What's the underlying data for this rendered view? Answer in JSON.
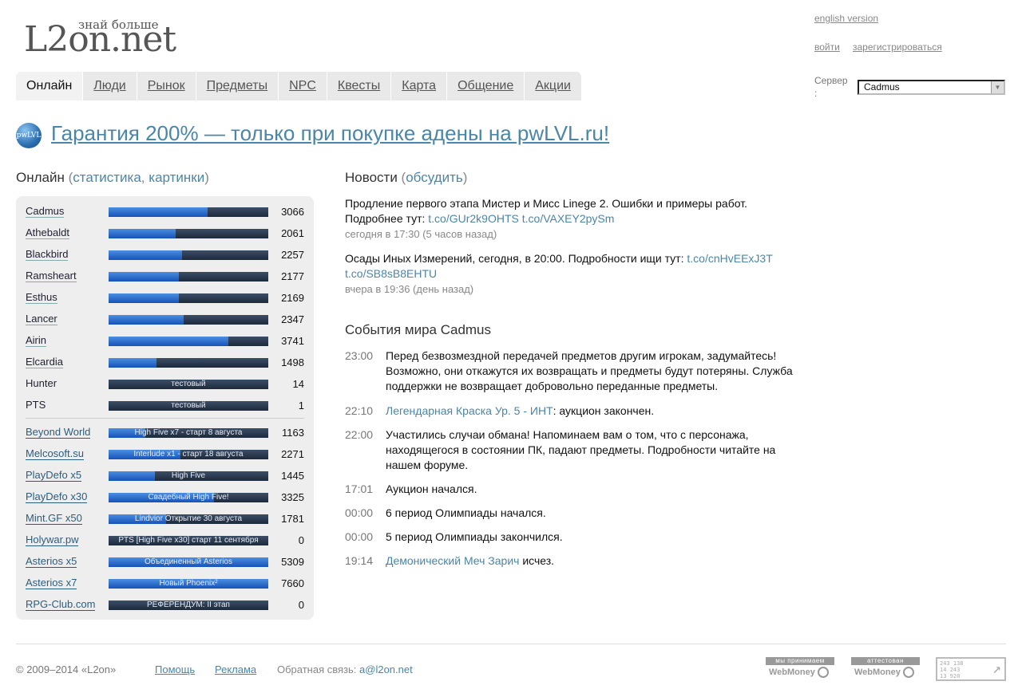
{
  "header": {
    "logo_text": "L2on.net",
    "logo_tagline": "знай больше",
    "english_link": "english version",
    "login_link": "войти",
    "register_link": "зарегистрироваться",
    "server_label": "Сервер :",
    "server_selected": "Cadmus"
  },
  "tabs": [
    {
      "label": "Онлайн",
      "active": true
    },
    {
      "label": "Люди"
    },
    {
      "label": "Рынок"
    },
    {
      "label": "Предметы"
    },
    {
      "label": "NPC"
    },
    {
      "label": "Квесты"
    },
    {
      "label": "Карта"
    },
    {
      "label": "Общение"
    },
    {
      "label": "Акции"
    }
  ],
  "banner": {
    "icon_text": "pwLVL",
    "text": "Гарантия 200% — только при покупке адены на pwLVL.ru!"
  },
  "online": {
    "title": "Онлайн",
    "paren_open": "(",
    "stats_link": "статистика",
    "comma": ",",
    "pics_link": "картинки",
    "paren_close": ")",
    "servers": [
      {
        "name": "Cadmus",
        "count": "3066",
        "fill": 0.62
      },
      {
        "name": "Athebaldt",
        "count": "2061",
        "fill": 0.42
      },
      {
        "name": "Blackbird",
        "count": "2257",
        "fill": 0.46
      },
      {
        "name": "Ramsheart",
        "count": "2177",
        "fill": 0.44
      },
      {
        "name": "Esthus",
        "count": "2169",
        "fill": 0.44
      },
      {
        "name": "Lancer",
        "count": "2347",
        "fill": 0.47
      },
      {
        "name": "Airin",
        "count": "3741",
        "fill": 0.75
      },
      {
        "name": "Elcardia",
        "count": "1498",
        "fill": 0.3
      },
      {
        "name": "Hunter",
        "count": "14",
        "fill": 0,
        "bar_text": "тестовый"
      },
      {
        "name": "PTS",
        "count": "1",
        "fill": 0,
        "bar_text": "тестовый"
      }
    ],
    "partners": [
      {
        "name": "Beyond World",
        "count": "1163",
        "fill": 0.23,
        "bar_text": "High Five x7 - старт 8 августа"
      },
      {
        "name": "Melcosoft.su",
        "count": "2271",
        "fill": 0.45,
        "bar_text": "Interlude x1 - старт 18 августа"
      },
      {
        "name": "PlayDefo x5",
        "count": "1445",
        "fill": 0.29,
        "bar_text": "High Five"
      },
      {
        "name": "PlayDefo x30",
        "count": "3325",
        "fill": 0.66,
        "bar_text": "Свадебный High Five!"
      },
      {
        "name": "Mint.GF x50",
        "count": "1781",
        "fill": 0.36,
        "bar_text": "Lindvior Открытие 30 августа"
      },
      {
        "name": "Holywar.pw",
        "count": "0",
        "fill": 0,
        "bar_text": "PTS [High Five x30] старт 11 сентября"
      },
      {
        "name": "Asterios x5",
        "count": "5309",
        "fill": 1.0,
        "bar_text": "Объединенный Asterios"
      },
      {
        "name": "Asterios x7",
        "count": "7660",
        "fill": 1.0,
        "bar_text": "Новый Phoenix²"
      },
      {
        "name": "RPG-Club.com",
        "count": "0",
        "fill": 0,
        "bar_text": "РЕФЕРЕНДУМ: II этап"
      }
    ]
  },
  "news": {
    "title": "Новости",
    "paren_open": "(",
    "discuss_link": "обсудить",
    "paren_close": ")",
    "items": [
      {
        "text": "Продление первого этапа Мистер и Мисс Linege 2. Ошибки и примеры работ. Подробнее тут:",
        "link1": "t.co/GUr2k9OHTS",
        "link2": "t.co/VAXEY2pySm",
        "when": "сегодня в 17:30 (5 часов назад)"
      },
      {
        "text": "Осады Иных Измерений, сегодня, в 20:00. Подробности ищи тут:",
        "link1": "t.co/cnHvEExJ3T",
        "link2": "t.co/SB8sB8EHTU",
        "when": "вчера в 19:36 (день назад)"
      }
    ]
  },
  "events": {
    "title": "События мира Cadmus",
    "items": [
      {
        "time": "23:00",
        "text": "Перед безвозмездной передачей предметов другим игрокам, задумайтесь! Возможно, они откажутся их возвращать и предметы будут потеряны. Служба поддержки не возвращает добровольно переданные предметы."
      },
      {
        "time": "22:10",
        "link": "Легендарная Краска Ур. 5 - ИНТ",
        "text": ": аукцион закончен."
      },
      {
        "time": "22:00",
        "text": "Участились случаи обмана! Напоминаем вам о том, что с персонажа, находящегося в состоянии ПК, падают предметы. Подробности читайте на нашем форуме."
      },
      {
        "time": "17:01",
        "text": "Аукцион начался."
      },
      {
        "time": "00:00",
        "text": "6 период Олимпиады начался."
      },
      {
        "time": "00:00",
        "text": "5 период Олимпиады закончился."
      },
      {
        "time": "19:14",
        "link": "Демонический Меч Зарич",
        "text": " исчез."
      }
    ]
  },
  "footer": {
    "copyright": "© 2009–2014 «L2on»",
    "help": "Помощь",
    "ads": "Реклама",
    "feedback": "Обратная связь:",
    "email": "a@l2on.net",
    "badge1_top": "мы принимаем",
    "badge1_bottom": "WebMoney",
    "badge2_top": "аттестован",
    "badge2_bottom": "WebMoney",
    "counter_lines": [
      "243 138",
      "14 243",
      "13 920"
    ]
  },
  "colors": {
    "link": "#4a86a8",
    "bar_fill": "#1652b8",
    "bar_bg": "#1d2a3c",
    "panel_bg": "#eeeeee"
  }
}
